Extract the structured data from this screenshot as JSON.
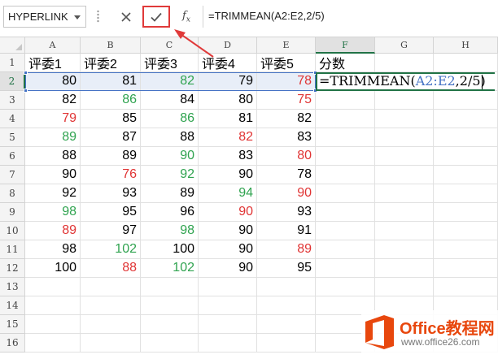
{
  "formula_bar": {
    "name_box": "HYPERLINK",
    "formula": "=TRIMMEAN(A2:E2,2/5)",
    "cancel_icon": "close-icon",
    "enter_icon": "check-icon",
    "fx_label": "fx"
  },
  "columns": [
    "A",
    "B",
    "C",
    "D",
    "E",
    "F",
    "G",
    "H"
  ],
  "active_column": "F",
  "active_row": "2",
  "rows": [
    {
      "num": "1",
      "cells": [
        {
          "v": "评委1",
          "t": "txt"
        },
        {
          "v": "评委2",
          "t": "txt"
        },
        {
          "v": "评委3",
          "t": "txt"
        },
        {
          "v": "评委4",
          "t": "txt"
        },
        {
          "v": "评委5",
          "t": "txt"
        },
        {
          "v": "分数",
          "t": "txt"
        }
      ]
    },
    {
      "num": "2",
      "cells": [
        {
          "v": "80"
        },
        {
          "v": "81"
        },
        {
          "v": "82",
          "c": "g"
        },
        {
          "v": "79"
        },
        {
          "v": "78",
          "c": "r"
        }
      ]
    },
    {
      "num": "3",
      "cells": [
        {
          "v": "82"
        },
        {
          "v": "86",
          "c": "g"
        },
        {
          "v": "84"
        },
        {
          "v": "80"
        },
        {
          "v": "75",
          "c": "r"
        }
      ]
    },
    {
      "num": "4",
      "cells": [
        {
          "v": "79",
          "c": "r"
        },
        {
          "v": "85"
        },
        {
          "v": "86",
          "c": "g"
        },
        {
          "v": "81"
        },
        {
          "v": "82"
        }
      ]
    },
    {
      "num": "5",
      "cells": [
        {
          "v": "89",
          "c": "g"
        },
        {
          "v": "87"
        },
        {
          "v": "88"
        },
        {
          "v": "82",
          "c": "r"
        },
        {
          "v": "83"
        }
      ]
    },
    {
      "num": "6",
      "cells": [
        {
          "v": "88"
        },
        {
          "v": "89"
        },
        {
          "v": "90",
          "c": "g"
        },
        {
          "v": "83"
        },
        {
          "v": "80",
          "c": "r"
        }
      ]
    },
    {
      "num": "7",
      "cells": [
        {
          "v": "90"
        },
        {
          "v": "76",
          "c": "r"
        },
        {
          "v": "92",
          "c": "g"
        },
        {
          "v": "90"
        },
        {
          "v": "78"
        }
      ]
    },
    {
      "num": "8",
      "cells": [
        {
          "v": "92"
        },
        {
          "v": "93"
        },
        {
          "v": "89"
        },
        {
          "v": "94",
          "c": "g"
        },
        {
          "v": "90",
          "c": "r"
        }
      ]
    },
    {
      "num": "9",
      "cells": [
        {
          "v": "98",
          "c": "g"
        },
        {
          "v": "95"
        },
        {
          "v": "96"
        },
        {
          "v": "90",
          "c": "r"
        },
        {
          "v": "93"
        }
      ]
    },
    {
      "num": "10",
      "cells": [
        {
          "v": "89",
          "c": "r"
        },
        {
          "v": "97"
        },
        {
          "v": "98",
          "c": "g"
        },
        {
          "v": "90"
        },
        {
          "v": "91"
        }
      ]
    },
    {
      "num": "11",
      "cells": [
        {
          "v": "98"
        },
        {
          "v": "102",
          "c": "g"
        },
        {
          "v": "100"
        },
        {
          "v": "90"
        },
        {
          "v": "89",
          "c": "r"
        }
      ]
    },
    {
      "num": "12",
      "cells": [
        {
          "v": "100"
        },
        {
          "v": "88",
          "c": "r"
        },
        {
          "v": "102",
          "c": "g"
        },
        {
          "v": "90"
        },
        {
          "v": "95"
        }
      ]
    },
    {
      "num": "13",
      "cells": []
    },
    {
      "num": "14",
      "cells": []
    },
    {
      "num": "15",
      "cells": []
    },
    {
      "num": "16",
      "cells": []
    }
  ],
  "editing": {
    "prefix": "=TRIMMEAN(",
    "range": "A2:E2",
    "suffix": ",2/5)"
  },
  "colors": {
    "red": "#e03434",
    "green": "#2fa34f",
    "selection_blue": "#4472c4",
    "excel_green": "#217346",
    "annotation_red": "#e03a3a",
    "watermark_orange": "#e8470d"
  },
  "watermark": {
    "title": "Office教程网",
    "url": "www.office26.com",
    "logo_icon": "office-logo-icon"
  }
}
